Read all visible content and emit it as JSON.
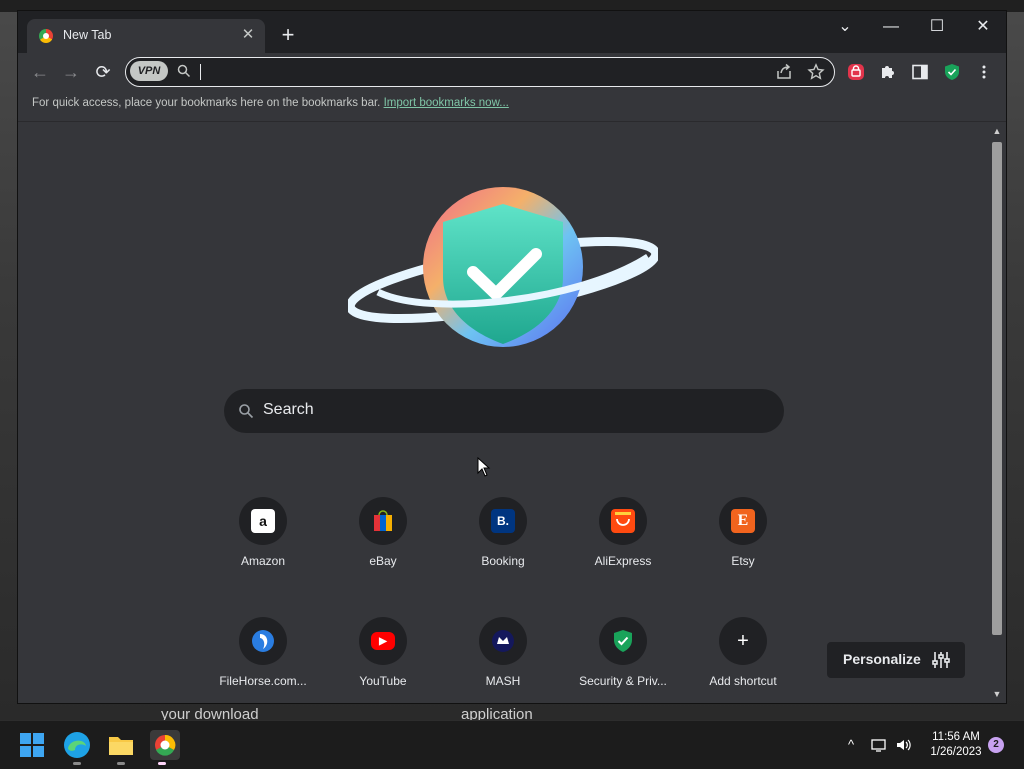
{
  "browser": {
    "tab": {
      "title": "New Tab",
      "close": "✕"
    },
    "new_tab": "+",
    "window_controls": {
      "dropdown": "⌄",
      "minimize": "—",
      "maximize": "☐",
      "close": "✕"
    },
    "nav": {
      "back": "←",
      "forward": "→",
      "reload": "⟳"
    },
    "omnibox": {
      "vpn_label": "VPN",
      "value": ""
    },
    "bookmarks_bar": {
      "hint": "For quick access, place your bookmarks here on the bookmarks bar.",
      "import_link": "Import bookmarks now..."
    }
  },
  "newtab": {
    "search_label": "Search",
    "shortcuts_row1": [
      {
        "label": "Amazon",
        "glyph": "a"
      },
      {
        "label": "eBay",
        "glyph": ""
      },
      {
        "label": "Booking",
        "glyph": "B."
      },
      {
        "label": "AliExpress",
        "glyph": ""
      },
      {
        "label": "Etsy",
        "glyph": "E"
      }
    ],
    "shortcuts_row2": [
      {
        "label": "FileHorse.com...",
        "glyph": ""
      },
      {
        "label": "YouTube",
        "glyph": "▶"
      },
      {
        "label": "MASH",
        "glyph": ""
      },
      {
        "label": "Security & Priv...",
        "glyph": "✓"
      },
      {
        "label": "Add shortcut",
        "glyph": "+"
      }
    ],
    "personalize_label": "Personalize"
  },
  "desktop": {
    "text_left": "your download",
    "text_right": "application"
  },
  "taskbar": {
    "time": "11:56 AM",
    "date": "1/26/2023",
    "notifications": "2"
  },
  "colors": {
    "accent_green": "#7fc5a6",
    "tab_bg": "#35363a",
    "frame": "#202124"
  }
}
